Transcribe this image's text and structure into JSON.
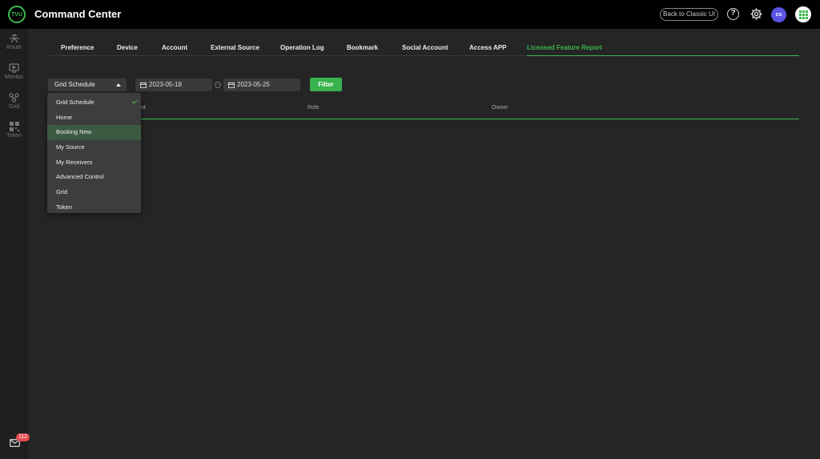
{
  "header": {
    "logo": "TVU",
    "app_title": "Command Center",
    "classic_button": "Back to Classic UI",
    "help": "?",
    "avatar_initials": "cs"
  },
  "sidebar": {
    "items": [
      {
        "label": "Route",
        "icon": "route-icon"
      },
      {
        "label": "Monitor",
        "icon": "monitor-icon"
      },
      {
        "label": "Grid",
        "icon": "grid-icon"
      },
      {
        "label": "Token",
        "icon": "token-icon"
      }
    ],
    "mail_badge": "112"
  },
  "tabs": [
    "Preference",
    "Device",
    "Account",
    "External Source",
    "Operation Log",
    "Bookmark",
    "Social Account",
    "Access APP",
    "Licensed Feature Report"
  ],
  "active_tab": "Licensed Feature Report",
  "filters": {
    "selected_module": "Grid Schedule",
    "start_date": "2023-05-18",
    "end_date": "2023-05-25",
    "filter_button": "Filter"
  },
  "table": {
    "headers": [
      "nt",
      "Role",
      "Owner"
    ]
  },
  "dropdown": {
    "options": [
      "Grid Schedule",
      "Home",
      "Booking New",
      "My Source",
      "My Receivers",
      "Advanced Control",
      "Grid",
      "Token"
    ],
    "checked": "Grid Schedule",
    "highlighted": "Booking New"
  },
  "colors": {
    "accent": "#3cb84f",
    "avatar": "#5b55e6",
    "badge": "#e5484d"
  }
}
